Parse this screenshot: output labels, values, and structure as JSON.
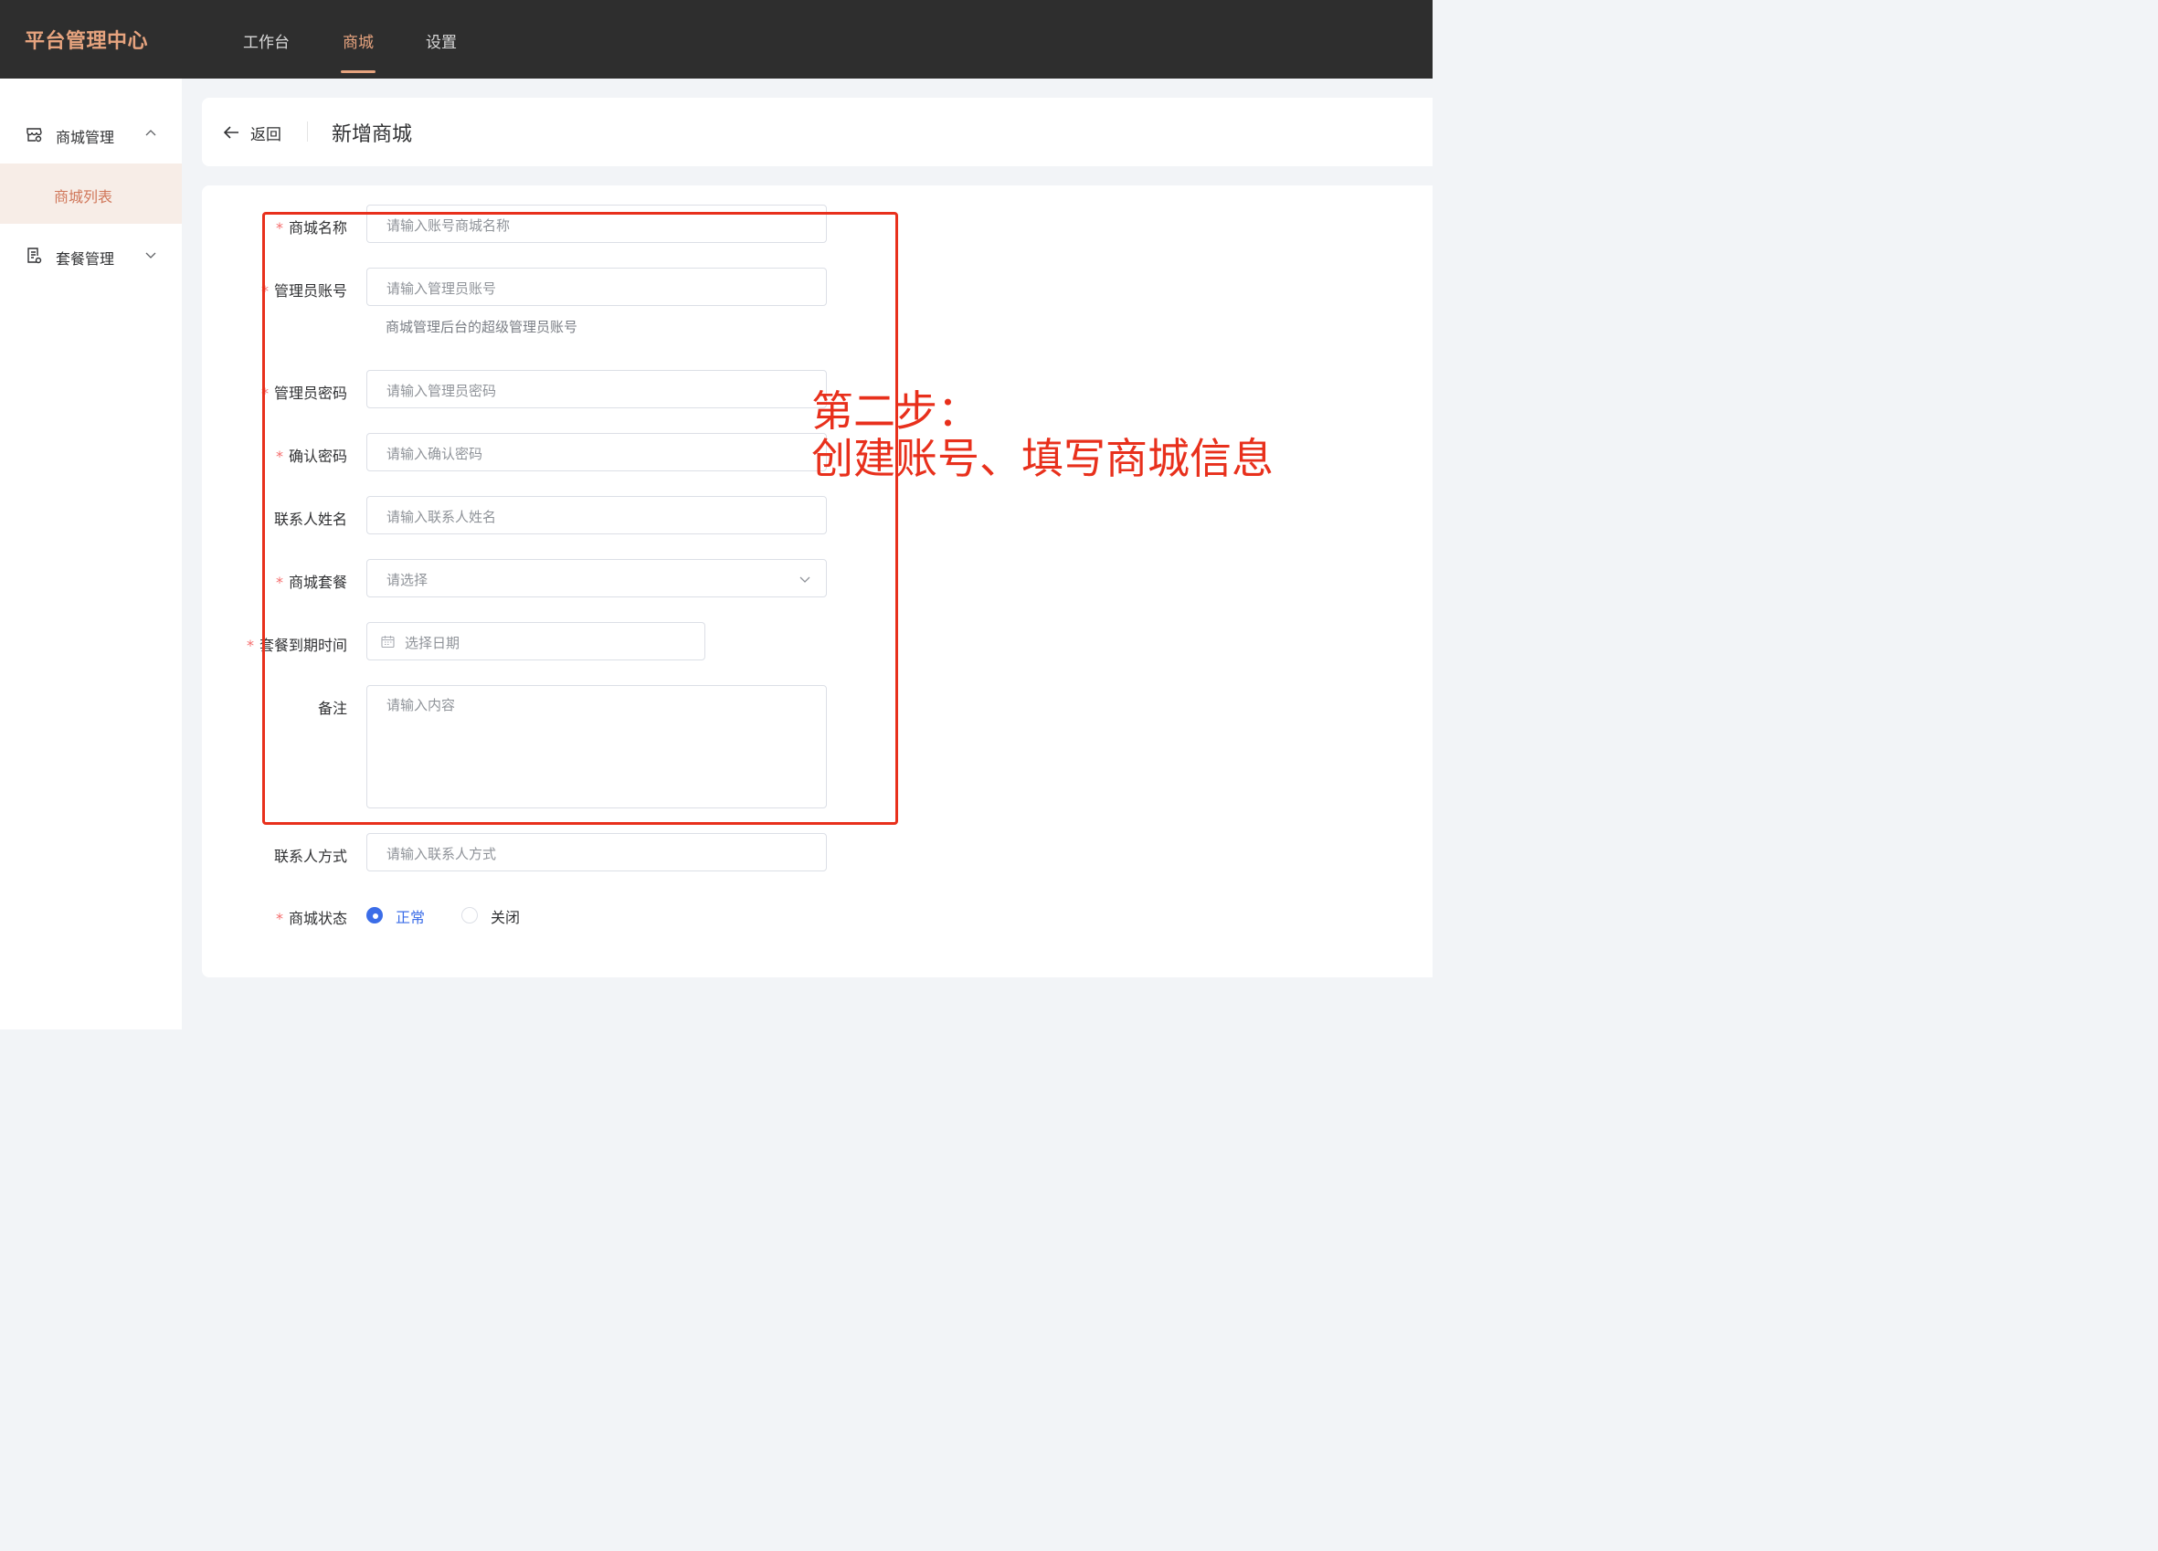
{
  "topbar": {
    "brand": "平台管理中心",
    "nav": [
      {
        "label": "工作台",
        "active": false
      },
      {
        "label": "商城",
        "active": true
      },
      {
        "label": "设置",
        "active": false
      }
    ]
  },
  "sidebar": {
    "groups": [
      {
        "label": "商城管理",
        "expanded": true,
        "icon": "store-icon",
        "children": [
          {
            "label": "商城列表",
            "active": true
          }
        ]
      },
      {
        "label": "套餐管理",
        "expanded": false,
        "icon": "package-list-icon"
      }
    ]
  },
  "header": {
    "back_label": "返回",
    "title": "新增商城"
  },
  "form": {
    "fields": [
      {
        "label": "商城名称",
        "required": true,
        "placeholder": "请输入账号商城名称"
      },
      {
        "label": "管理员账号",
        "required": true,
        "placeholder": "请输入管理员账号",
        "help": "商城管理后台的超级管理员账号"
      },
      {
        "label": "管理员密码",
        "required": true,
        "placeholder": "请输入管理员密码"
      },
      {
        "label": "确认密码",
        "required": true,
        "placeholder": "请输入确认密码"
      },
      {
        "label": "联系人姓名",
        "required": false,
        "placeholder": "请输入联系人姓名"
      },
      {
        "label": "商城套餐",
        "required": true,
        "placeholder": "请选择"
      },
      {
        "label": "套餐到期时间",
        "required": true,
        "placeholder": "选择日期"
      },
      {
        "label": "备注",
        "required": false,
        "placeholder": "请输入内容"
      },
      {
        "label": "联系人方式",
        "required": false,
        "placeholder": "请输入联系人方式"
      },
      {
        "label": "商城状态",
        "required": true
      }
    ],
    "status_options": [
      {
        "label": "正常",
        "checked": true
      },
      {
        "label": "关闭",
        "checked": false
      }
    ],
    "required_mark": "*"
  },
  "annotation": {
    "line1": "第二步：",
    "line2": "创建账号、填写商城信息"
  },
  "colors": {
    "accent": "#e6a37e",
    "sidebar_active": "#d0775a",
    "primary": "#3b6de8",
    "annotation": "#e8301c"
  }
}
